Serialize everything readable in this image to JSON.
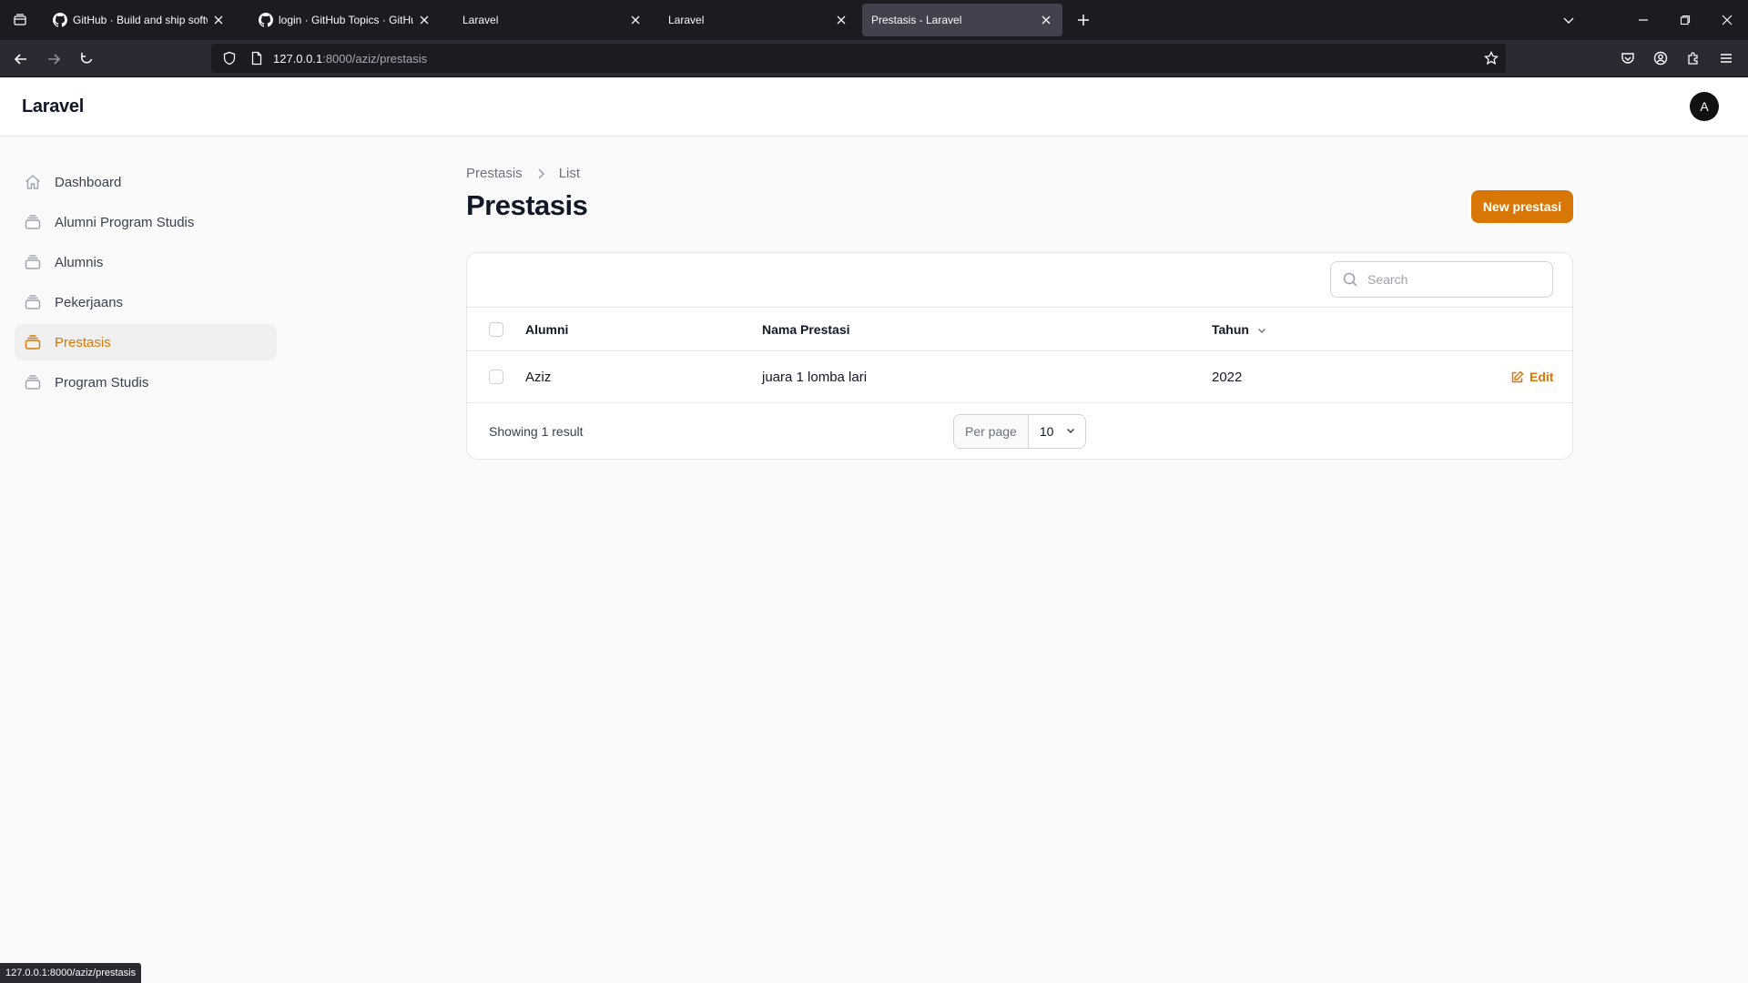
{
  "browser": {
    "tabs": [
      {
        "title": "GitHub · Build and ship software",
        "icon": "github-icon",
        "active": false
      },
      {
        "title": "login · GitHub Topics · GitHub",
        "icon": "github-icon",
        "active": false
      },
      {
        "title": "Laravel",
        "icon": "",
        "active": false
      },
      {
        "title": "Laravel",
        "icon": "",
        "active": false
      },
      {
        "title": "Prestasis - Laravel",
        "icon": "",
        "active": true
      }
    ],
    "url_host": "127.0.0.1",
    "url_rest": ":8000/aziz/prestasis",
    "status_url": "127.0.0.1:8000/aziz/prestasis"
  },
  "app": {
    "brand": "Laravel",
    "avatar_initial": "A",
    "accent_color": "#d97706"
  },
  "sidebar": {
    "items": [
      {
        "label": "Dashboard",
        "icon": "home-icon",
        "active": false
      },
      {
        "label": "Alumni Program Studis",
        "icon": "collection-icon",
        "active": false
      },
      {
        "label": "Alumnis",
        "icon": "collection-icon",
        "active": false
      },
      {
        "label": "Pekerjaans",
        "icon": "collection-icon",
        "active": false
      },
      {
        "label": "Prestasis",
        "icon": "collection-icon",
        "active": true
      },
      {
        "label": "Program Studis",
        "icon": "collection-icon",
        "active": false
      }
    ]
  },
  "page": {
    "breadcrumb": [
      "Prestasis",
      "List"
    ],
    "title": "Prestasis",
    "new_button": "New prestasi"
  },
  "table": {
    "search_placeholder": "Search",
    "columns": [
      "Alumni",
      "Nama Prestasi",
      "Tahun"
    ],
    "rows": [
      {
        "alumni": "Aziz",
        "nama_prestasi": "juara 1 lomba lari",
        "tahun": "2022",
        "action": "Edit"
      }
    ],
    "showing": "Showing 1 result",
    "per_page_label": "Per page",
    "per_page_value": "10"
  }
}
